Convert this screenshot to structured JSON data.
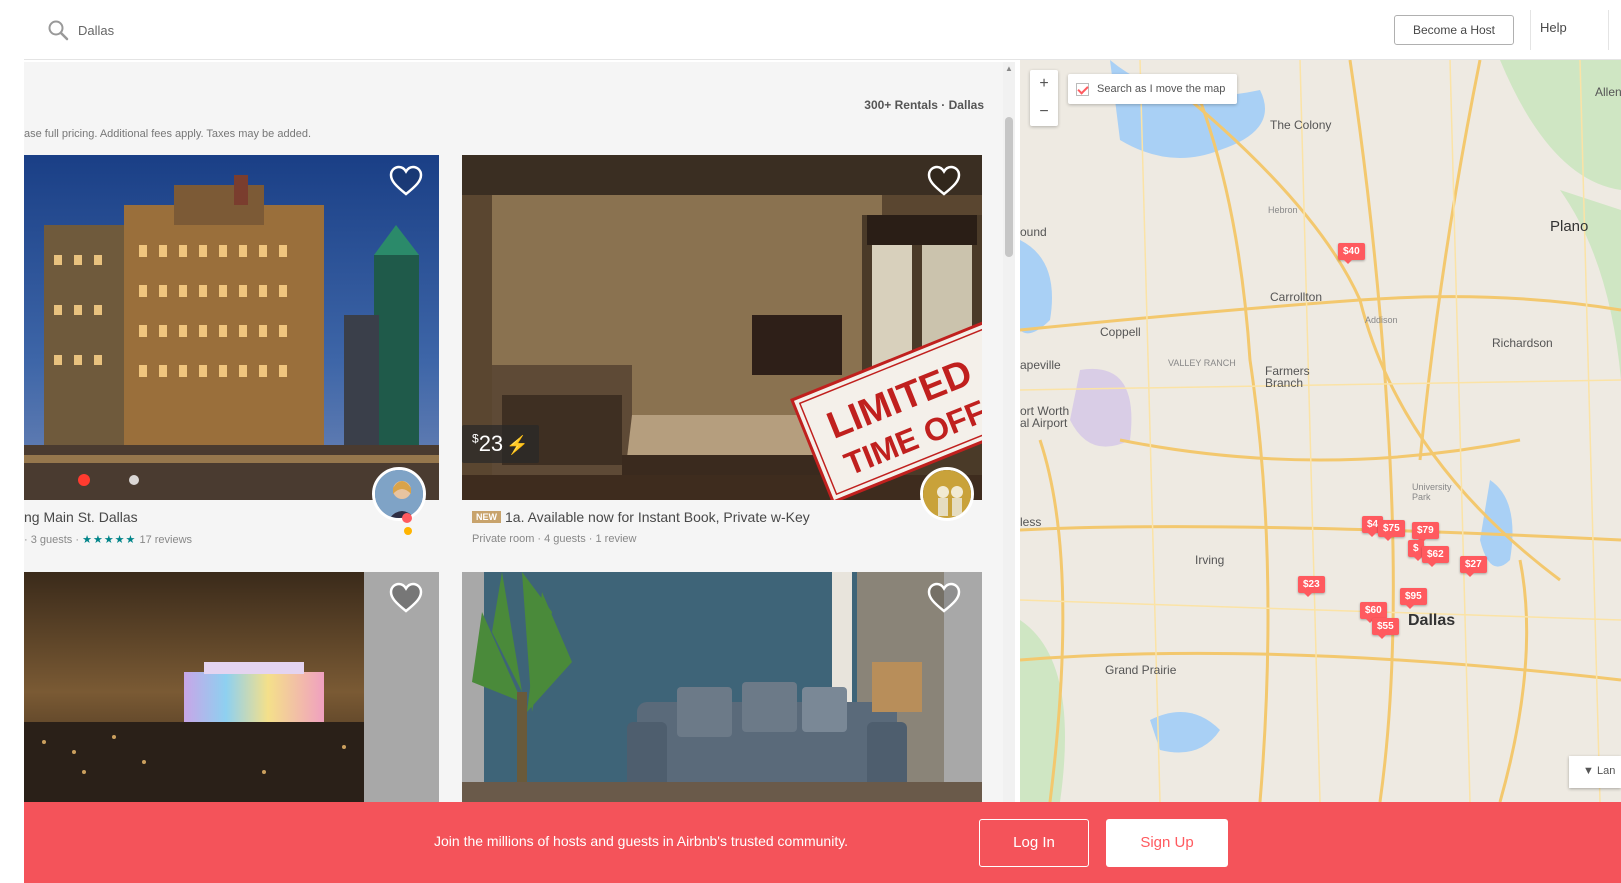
{
  "header": {
    "search_value": "Dallas",
    "become_host_label": "Become a Host",
    "help_label": "Help"
  },
  "listings": {
    "rentals_count": "300+ Rentals · Dallas",
    "pricing_note": "ase full pricing. Additional fees apply. Taxes may be added.",
    "cards": [
      {
        "title": "ng Main St. Dallas",
        "meta_prefix": "· 3 guests ·",
        "stars": "★★★★★",
        "reviews": "17 reviews"
      },
      {
        "price": "23",
        "price_currency": "$",
        "new_badge": "NEW",
        "title": "1a. Available now for Instant Book, Private w-Key",
        "meta": "Private room · 4 guests · 1 review",
        "promo_line1": "LIMITED",
        "promo_line2": "TIME OFF"
      },
      {},
      {}
    ]
  },
  "map": {
    "search_as_move": "Search as I move the map",
    "zoom_in": "+",
    "zoom_out": "−",
    "labels": {
      "plano": "Plano",
      "the_colony": "The Colony",
      "hebron": "Hebron",
      "carrollton": "Carrollton",
      "addison": "Addison",
      "richardson": "Richardson",
      "coppell": "Coppell",
      "farmers_branch": "Farmers Branch",
      "irving": "Irving",
      "dallas": "Dallas",
      "grand_prairie": "Grand Prairie",
      "university_park": "University Park",
      "ound": "ound",
      "apeville": "apeville",
      "airport": "ort Worth\nal Airport",
      "fess": "less",
      "valley_ranch": "VALLEY RANCH",
      "allen": "Allen"
    },
    "pins": [
      "$40",
      "$4",
      "$75",
      "$79",
      "$",
      "$62",
      "$27",
      "$23",
      "$95",
      "$60",
      "$55"
    ],
    "bottom_button": "Lan"
  },
  "banner": {
    "text": "Join the millions of hosts and guests in Airbnb's trusted community.",
    "login_label": "Log In",
    "signup_label": "Sign Up"
  },
  "colors": {
    "brand": "#ff5a5f",
    "banner": "#f4535a",
    "star": "#008489"
  }
}
